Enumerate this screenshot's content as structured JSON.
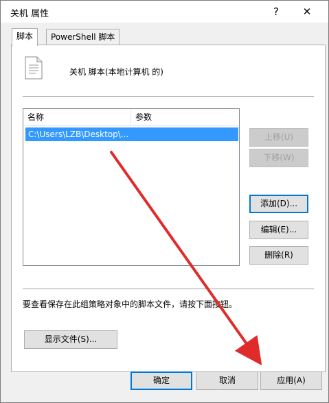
{
  "window": {
    "title": "关机 属性",
    "help": "?",
    "close": "✕"
  },
  "tabs": [
    {
      "label": "脚本"
    },
    {
      "label": "PowerShell 脚本"
    }
  ],
  "header": {
    "text": "关机 脚本(本地计算机 的)"
  },
  "list": {
    "columns": [
      "名称",
      "参数"
    ],
    "rows": [
      {
        "name": "C:\\Users\\LZB\\Desktop\\...",
        "params": ""
      }
    ]
  },
  "side_buttons": {
    "up": "上移(U)",
    "down": "下移(W)",
    "add": "添加(D)...",
    "edit": "编辑(E)...",
    "remove": "删除(R)"
  },
  "hint": "要查看保存在此组策略对象中的脚本文件，请按下面按钮。",
  "show_files": "显示文件(S)...",
  "dialog_buttons": {
    "ok": "确定",
    "cancel": "取消",
    "apply": "应用(A)"
  },
  "colors": {
    "accent": "#0078d7",
    "selection": "#3399ff",
    "arrow": "#e02b2b"
  },
  "icons": {
    "file": "script-file-icon"
  }
}
